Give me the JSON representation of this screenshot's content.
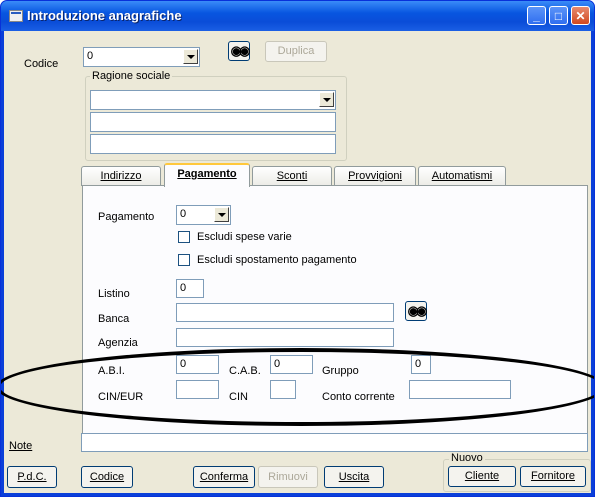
{
  "window": {
    "title": "Introduzione anagrafiche",
    "controls": {
      "minimize": "_",
      "maximize": "□",
      "close": "✕"
    }
  },
  "header": {
    "codice_label": "Codice",
    "codice_value": "0",
    "search_icon": "binoculars-icon",
    "duplica_label": "Duplica"
  },
  "ragione_sociale": {
    "group_label": "Ragione sociale",
    "combo_value": "",
    "line2": "",
    "line3": ""
  },
  "tabs": [
    {
      "label": "Indirizzo"
    },
    {
      "label": "Pagamento",
      "active": true
    },
    {
      "label": "Sconti"
    },
    {
      "label": "Provvigioni"
    },
    {
      "label": "Automatismi"
    }
  ],
  "pagamento": {
    "pagamento_label": "Pagamento",
    "pagamento_value": "0",
    "escludi_spese_label": "Escludi spese varie",
    "escludi_spostamento_label": "Escludi spostamento pagamento",
    "listino_label": "Listino",
    "listino_value": "0",
    "banca_label": "Banca",
    "banca_value": "",
    "agenzia_label": "Agenzia",
    "agenzia_value": "",
    "abi_label": "A.B.I.",
    "abi_value": "0",
    "cab_label": "C.A.B.",
    "cab_value": "0",
    "gruppo_label": "Gruppo",
    "gruppo_value": "0",
    "cin_eur_label": "CIN/EUR",
    "cin_eur_value": "",
    "cin_label": "CIN",
    "cin_value": "",
    "conto_label": "Conto corrente",
    "conto_value": ""
  },
  "note": {
    "label": "Note",
    "value": ""
  },
  "footer": {
    "pdc_label": "P.d.C.",
    "codice_label": "Codice",
    "conferma_label": "Conferma",
    "rimuovi_label": "Rimuovi",
    "uscita_label": "Uscita",
    "nuovo_group_label": "Nuovo",
    "cliente_label": "Cliente",
    "fornitore_label": "Fornitore"
  },
  "colors": {
    "titlebar": "#0a4dd8",
    "face": "#ece9d8",
    "active_tab_accent": "#ffc83c",
    "annotation": "#000000"
  }
}
